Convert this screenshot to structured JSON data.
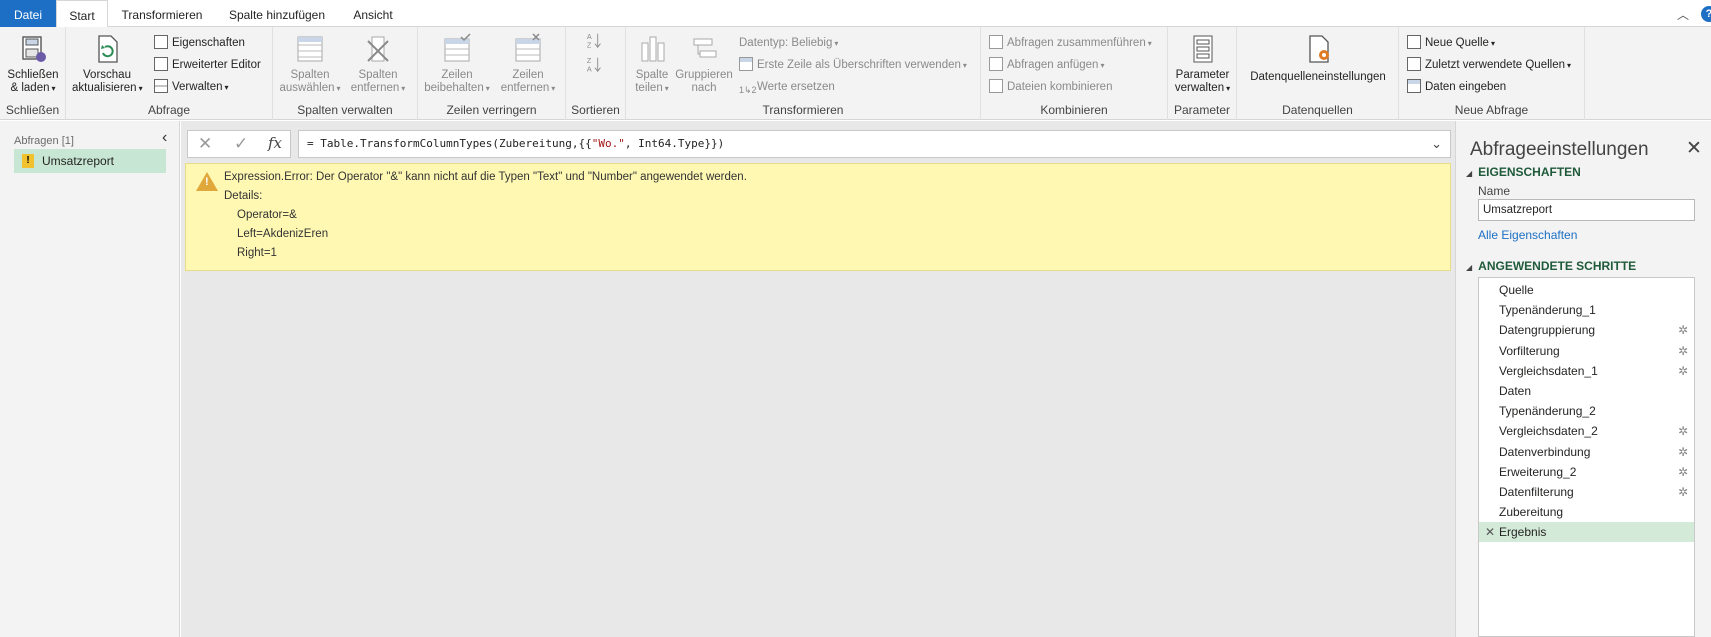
{
  "tabs": [
    {
      "label": "Datei"
    },
    {
      "label": "Start"
    },
    {
      "label": "Transformieren"
    },
    {
      "label": "Spalte hinzufügen"
    },
    {
      "label": "Ansicht"
    }
  ],
  "ribbon": {
    "close_load": {
      "label1": "Schließen",
      "label2": "& laden",
      "group": "Schließen"
    },
    "query": {
      "preview": {
        "label1": "Vorschau",
        "label2": "aktualisieren"
      },
      "properties": "Eigenschaften",
      "advanced_editor": "Erweiterter Editor",
      "manage": "Verwalten",
      "group": "Abfrage"
    },
    "manage_columns": {
      "choose": {
        "label1": "Spalten",
        "label2": "auswählen"
      },
      "remove": {
        "label1": "Spalten",
        "label2": "entfernen"
      },
      "group": "Spalten verwalten"
    },
    "reduce_rows": {
      "keep": {
        "label1": "Zeilen",
        "label2": "beibehalten"
      },
      "remove": {
        "label1": "Zeilen",
        "label2": "entfernen"
      },
      "group": "Zeilen verringern"
    },
    "sort": {
      "group": "Sortieren"
    },
    "transform": {
      "split": {
        "label1": "Spalte",
        "label2": "teilen"
      },
      "group_by": {
        "label1": "Gruppieren",
        "label2": "nach"
      },
      "datatype": "Datentyp: Beliebig",
      "first_row": "Erste Zeile als Überschriften verwenden",
      "replace": "Werte ersetzen",
      "group": "Transformieren"
    },
    "combine": {
      "merge": "Abfragen zusammenführen",
      "append": "Abfragen anfügen",
      "combine_files": "Dateien kombinieren",
      "group": "Kombinieren"
    },
    "parameters": {
      "label1": "Parameter",
      "label2": "verwalten",
      "group": "Parameter"
    },
    "datasources": {
      "label": "Datenquelleneinstellungen",
      "group": "Datenquellen"
    },
    "new_query": {
      "new_source": "Neue Quelle",
      "recent": "Zuletzt verwendete Quellen",
      "enter_data": "Daten eingeben",
      "group": "Neue Abfrage"
    }
  },
  "queries": {
    "title": "Abfragen [1]",
    "items": [
      {
        "name": "Umsatzreport"
      }
    ]
  },
  "formula": {
    "prefix": "= Table.TransformColumnTypes(Zubereitung,{{",
    "string": "\"Wo.\"",
    "suffix": ", Int64.Type}})"
  },
  "error": {
    "message": "Expression.Error: Der Operator \"&\" kann nicht auf die Typen \"Text\" und \"Number\" angewendet werden.",
    "details_label": "Details:",
    "lines": [
      "Operator=&",
      "Left=AkdenizEren",
      "Right=1"
    ]
  },
  "settings": {
    "title": "Abfrageeinstellungen",
    "properties_header": "EIGENSCHAFTEN",
    "name_label": "Name",
    "name_value": "Umsatzreport",
    "all_properties": "Alle Eigenschaften",
    "steps_header": "ANGEWENDETE SCHRITTE",
    "steps": [
      {
        "name": "Quelle",
        "gear": false
      },
      {
        "name": "Typenänderung_1",
        "gear": false
      },
      {
        "name": "Datengruppierung",
        "gear": true
      },
      {
        "name": "Vorfilterung",
        "gear": true
      },
      {
        "name": "Vergleichsdaten_1",
        "gear": true
      },
      {
        "name": "Daten",
        "gear": false
      },
      {
        "name": "Typenänderung_2",
        "gear": false
      },
      {
        "name": "Vergleichsdaten_2",
        "gear": true
      },
      {
        "name": "Datenverbindung",
        "gear": true
      },
      {
        "name": "Erweiterung_2",
        "gear": true
      },
      {
        "name": "Datenfilterung",
        "gear": true
      },
      {
        "name": "Zubereitung",
        "gear": false
      },
      {
        "name": "Ergebnis",
        "gear": false,
        "active": true
      }
    ]
  },
  "colors": {
    "accent": "#1c6fc4",
    "selection": "#c7e6d3",
    "error_bg": "#fff8b3",
    "section_header": "#1f5a3a"
  }
}
